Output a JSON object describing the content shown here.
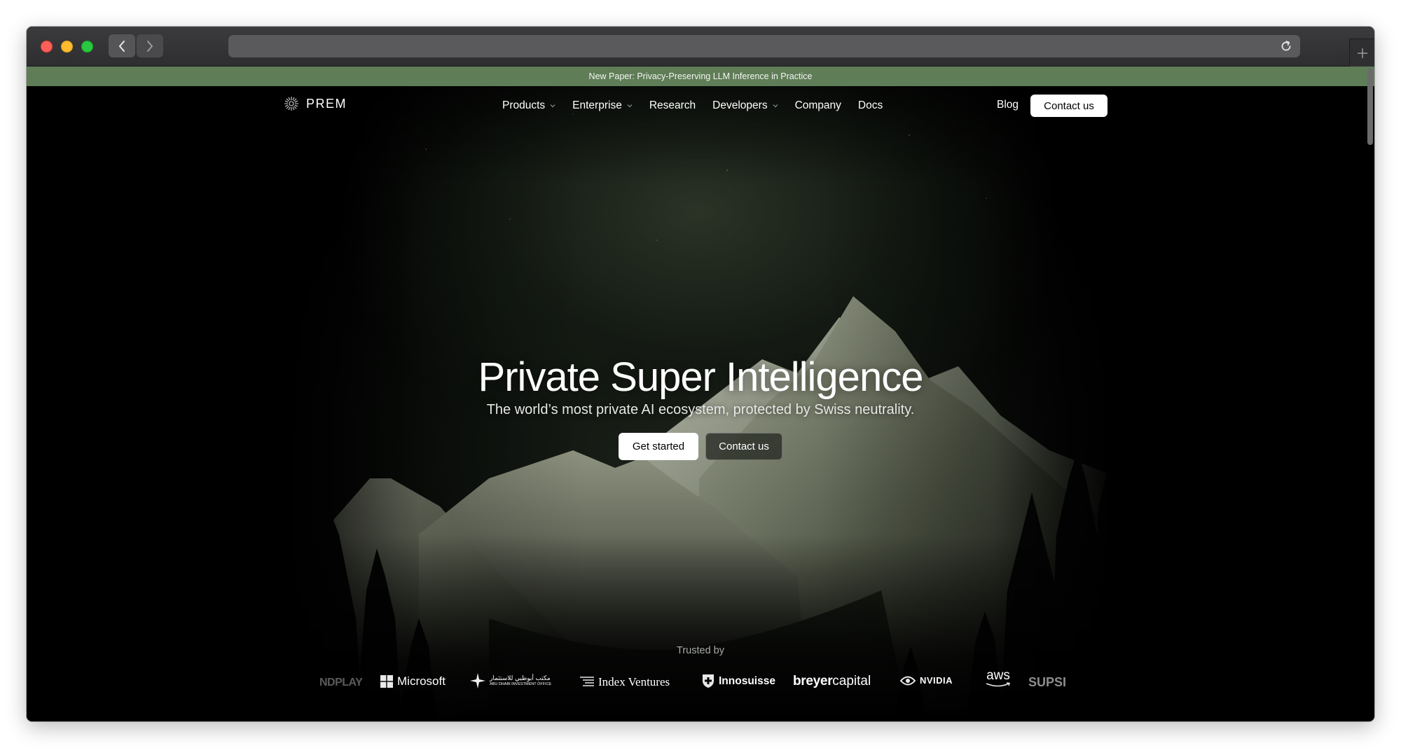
{
  "browser": {
    "back_icon": "chevron-left-icon",
    "forward_icon": "chevron-right-icon",
    "reload_icon": "reload-icon",
    "new_tab_icon": "plus-icon"
  },
  "banner": {
    "text": "New Paper: Privacy-Preserving LLM Inference in Practice",
    "color": "#5f7d57"
  },
  "nav": {
    "brand": "PREM",
    "items": [
      {
        "label": "Products",
        "has_dropdown": true
      },
      {
        "label": "Enterprise",
        "has_dropdown": true
      },
      {
        "label": "Research",
        "has_dropdown": false
      },
      {
        "label": "Developers",
        "has_dropdown": true
      },
      {
        "label": "Company",
        "has_dropdown": false
      },
      {
        "label": "Docs",
        "has_dropdown": false
      }
    ],
    "blog": "Blog",
    "contact": "Contact us"
  },
  "hero": {
    "title": "Private Super Intelligence",
    "subtitle": "The world’s most private AI ecosystem, protected by Swiss neutrality.",
    "primary_cta": "Get started",
    "secondary_cta": "Contact us"
  },
  "trusted": {
    "label": "Trusted by",
    "logos": [
      {
        "name": "NDPLAY"
      },
      {
        "name": "Microsoft"
      },
      {
        "name": "مكتب أبوظبي للاستثمار",
        "sub": "ABU DHABI INVESTMENT OFFICE"
      },
      {
        "name": "Index Ventures"
      },
      {
        "name": "Innosuisse"
      },
      {
        "name": "breyer",
        "name2": "capital"
      },
      {
        "name": "NVIDIA"
      },
      {
        "name": "aws"
      },
      {
        "name": "SUPSI"
      }
    ]
  }
}
